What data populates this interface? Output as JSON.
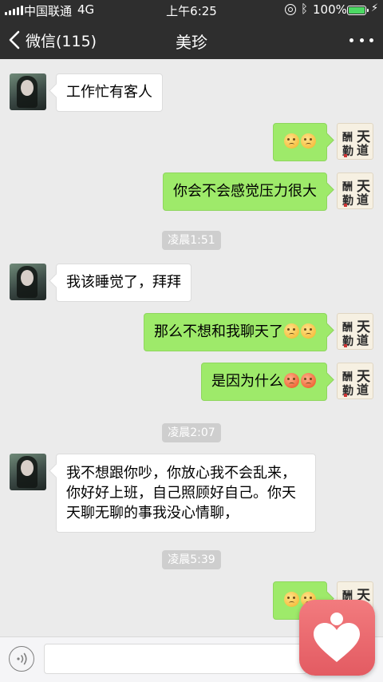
{
  "status_bar": {
    "carrier": "中国联通",
    "network": "4G",
    "time": "上午6:25",
    "battery_percent": "100%",
    "icons": [
      "signal-icon",
      "orientation-lock-icon",
      "bluetooth-icon",
      "battery-icon",
      "charging-icon"
    ]
  },
  "navbar": {
    "back_label": "微信(115)",
    "title": "美珍",
    "more_icon": "more-dots-icon"
  },
  "messages": [
    {
      "side": "left",
      "text": "工作忙有客人"
    },
    {
      "side": "right",
      "text": "",
      "emojis": [
        "blush-emoji",
        "blush-emoji"
      ]
    },
    {
      "side": "right",
      "text": "你会不会感觉压力很大"
    },
    {
      "type": "time",
      "text": "凌晨1:51"
    },
    {
      "side": "left",
      "text": "我该睡觉了，拜拜"
    },
    {
      "side": "right",
      "text": "那么不想和我聊天了",
      "emojis": [
        "sad-emoji",
        "blush-emoji"
      ]
    },
    {
      "side": "right",
      "text": "是因为什么",
      "emojis": [
        "angry-emoji",
        "angry-emoji"
      ]
    },
    {
      "type": "time",
      "text": "凌晨2:07"
    },
    {
      "side": "left",
      "lines": [
        "我不想跟你吵，你放心我不会乱来，",
        "你好好上班，自己照顾好自己。你天",
        "天聊无聊的事我没心情聊，"
      ]
    },
    {
      "type": "time",
      "text": "凌晨5:39"
    },
    {
      "side": "right",
      "text": "",
      "emojis": [
        "sad-emoji",
        "blush-emoji"
      ]
    }
  ],
  "avatars": {
    "contact": "contact-avatar",
    "self_calligraphy": [
      "天",
      "道",
      "酬",
      "勤"
    ]
  },
  "input_bar": {
    "voice_icon": "voice-icon",
    "text_value": ""
  },
  "overlay_app": {
    "icon": "heart-person-icon",
    "color": "#e8666b"
  },
  "colors": {
    "header": "#2e2e2e",
    "chat_bg": "#ebebeb",
    "self_bubble": "#9eea6a",
    "other_bubble": "#ffffff"
  }
}
